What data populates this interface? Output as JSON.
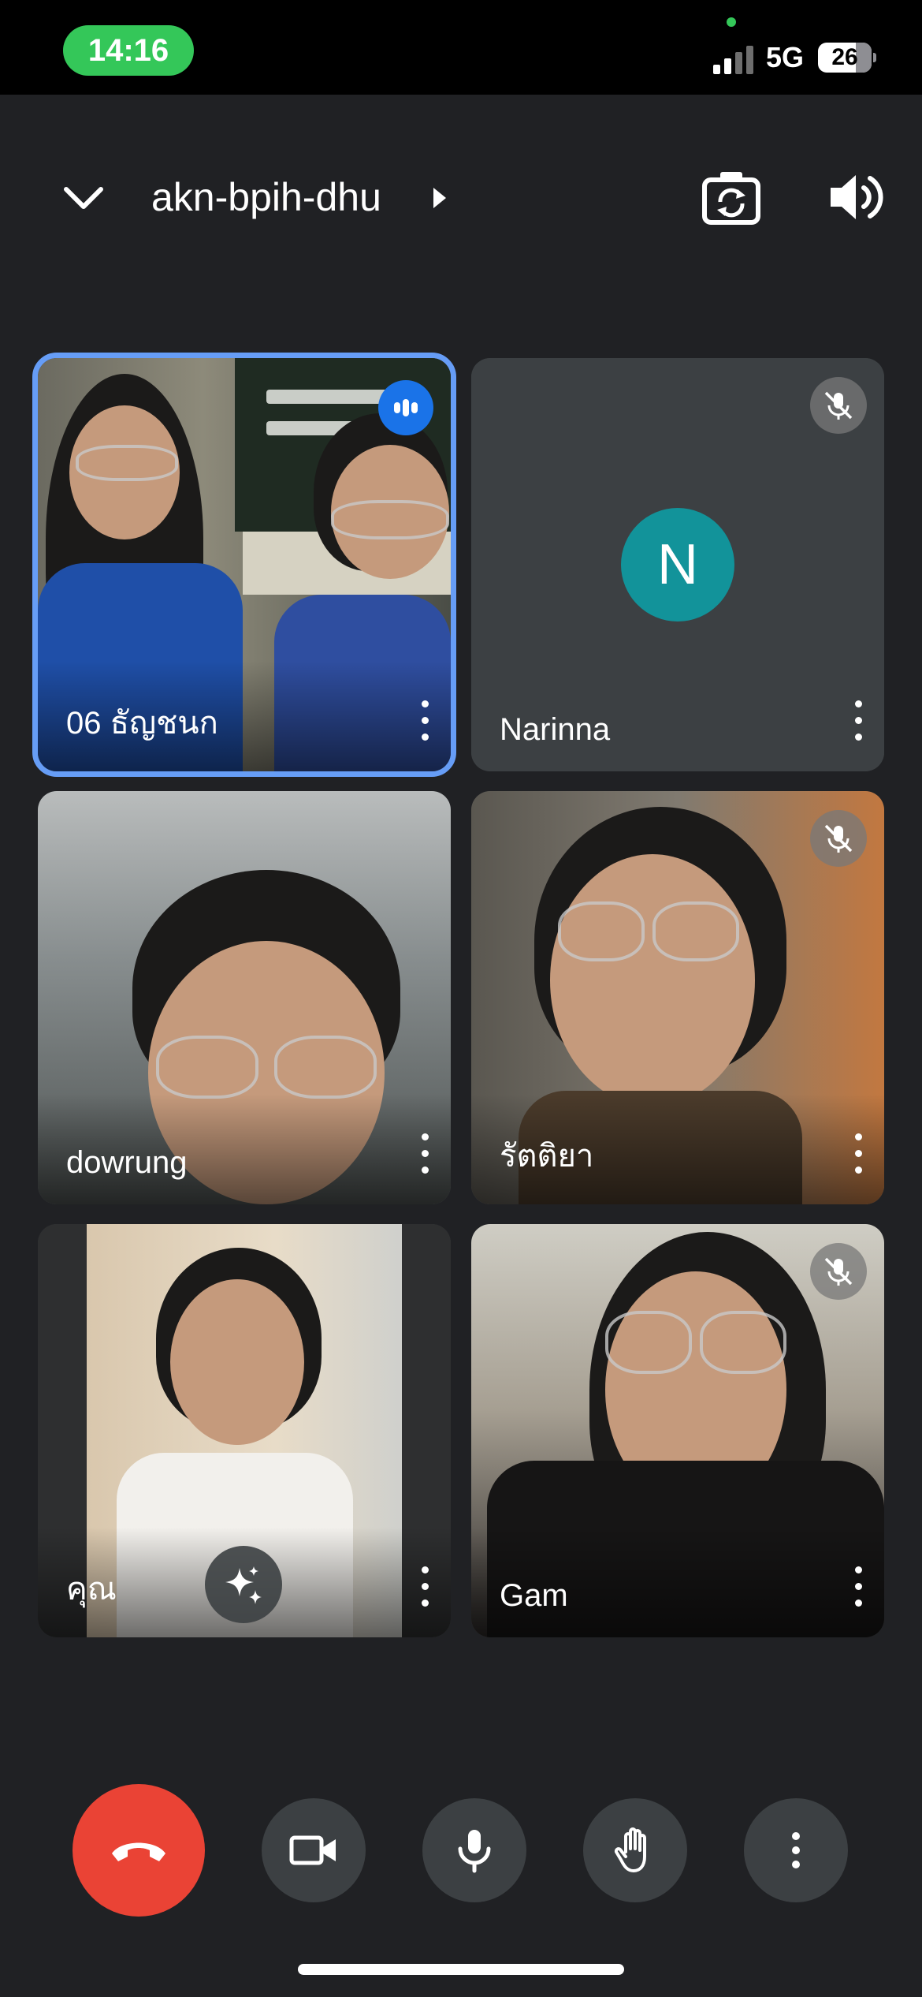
{
  "status_bar": {
    "time": "14:16",
    "network": "5G",
    "battery": "26"
  },
  "header": {
    "meeting_code": "akn-bpih-dhu",
    "icons": [
      "chevron-down-icon",
      "chevron-right-icon",
      "camera-flip-icon",
      "speaker-icon"
    ]
  },
  "participants": [
    {
      "name": "06 ธัญชนก",
      "speaking": true,
      "muted": false
    },
    {
      "name": "Narinna",
      "avatar_letter": "N",
      "muted": true,
      "avatar_color": "#12939a"
    },
    {
      "name": "dowrung",
      "muted": false
    },
    {
      "name": "รัตติยา",
      "muted": true
    },
    {
      "name": "คุณ",
      "muted": false,
      "effects_icon": "sparkle-icon"
    },
    {
      "name": "Gam",
      "muted": true
    }
  ],
  "controls": {
    "icons": [
      "end-call-icon",
      "camera-icon",
      "microphone-icon",
      "raise-hand-icon",
      "more-options-icon"
    ]
  },
  "colors": {
    "background": "#202124",
    "end_call": "#ea4335",
    "speaking_outline": "#669df6",
    "status_pill": "#34c759"
  }
}
